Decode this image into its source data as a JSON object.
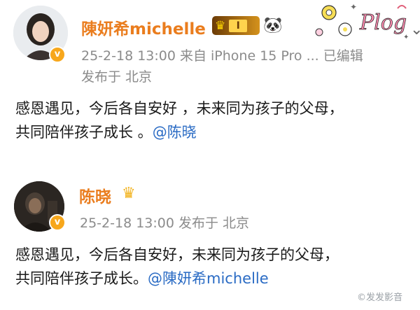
{
  "posts": [
    {
      "author": "陳妍希michelle",
      "meta_line1": "25-2-18 13:00   来自 iPhone 15 Pro ...   已编辑",
      "meta_line2": "发布于 北京",
      "body_line1": "感恩遇见，今后各自安好 ，未来同为孩子的父母，",
      "body_line2_prefix": "共同陪伴孩子成长 。",
      "mention": "@陈晓",
      "badge_level": "I",
      "badge_icon": "crown-icon",
      "extra_icon": "panda-icon",
      "decoration_text": "Plog",
      "colors": {
        "name": "#ea7d1e",
        "mention": "#2a6bc4",
        "meta": "#8b8b8b"
      }
    },
    {
      "author": "陈晓",
      "meta_line1": "25-2-18 13:00   发布于 北京",
      "body_line1": "感恩遇见，今后各自安好，未来同为孩子的父母，",
      "body_line2_prefix": "共同陪伴孩子成长。",
      "mention": "@陳妍希michelle",
      "badge_icon": "crown-icon"
    }
  ],
  "watermark": "©发发影音"
}
